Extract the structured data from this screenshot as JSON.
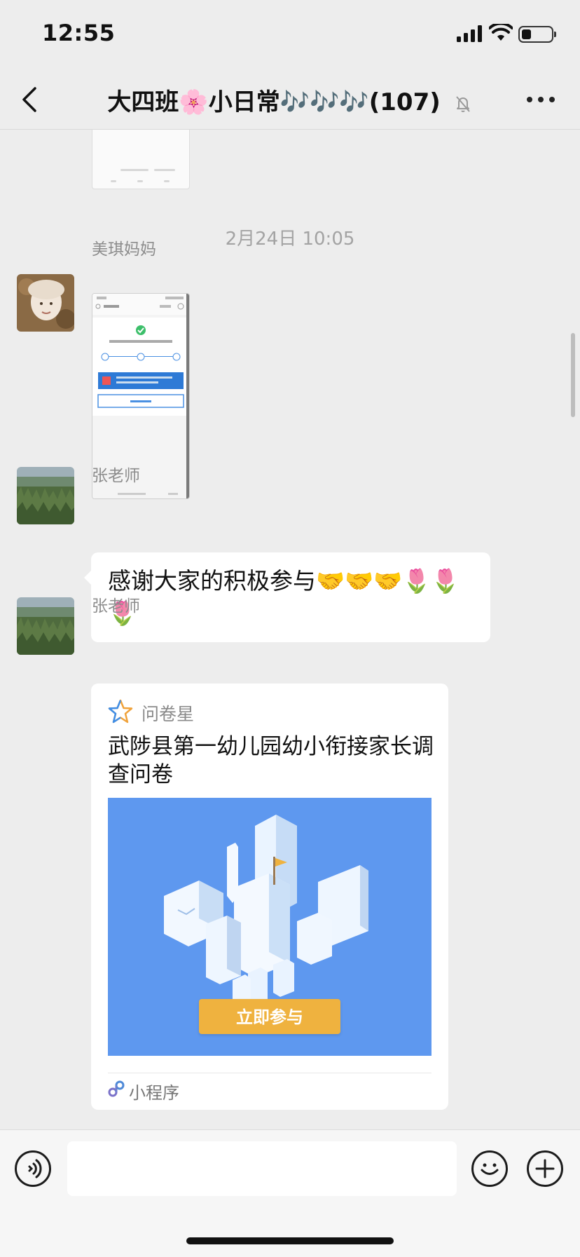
{
  "status_bar": {
    "time": "12:55",
    "battery_level": 0.3
  },
  "nav": {
    "title": "大四班🌸小日常🎶🎶🎶(107)",
    "icons": [
      "back-chevron-icon",
      "mute-bell-icon",
      "more-icon"
    ]
  },
  "chat": {
    "timestamp": "2月24日 10:05",
    "messages": [
      {
        "sender": "美琪妈妈",
        "type": "image"
      },
      {
        "sender": "张老师",
        "type": "text",
        "text": "感谢大家的积极参与🤝🤝🤝🌷🌷🌷"
      },
      {
        "sender": "张老师",
        "type": "mini-program",
        "source_name": "问卷星",
        "title": "武陟县第一幼儿园幼小衔接家长调查问卷",
        "button_label": "立即参与",
        "footer_label": "小程序"
      }
    ]
  },
  "input_bar": {
    "value": "",
    "icons": [
      "voice-icon",
      "emoji-icon",
      "plus-icon"
    ]
  },
  "colors": {
    "background": "#ededed",
    "bubble": "#ffffff",
    "card_banner": "#5e98ef",
    "button": "#efb23f"
  }
}
